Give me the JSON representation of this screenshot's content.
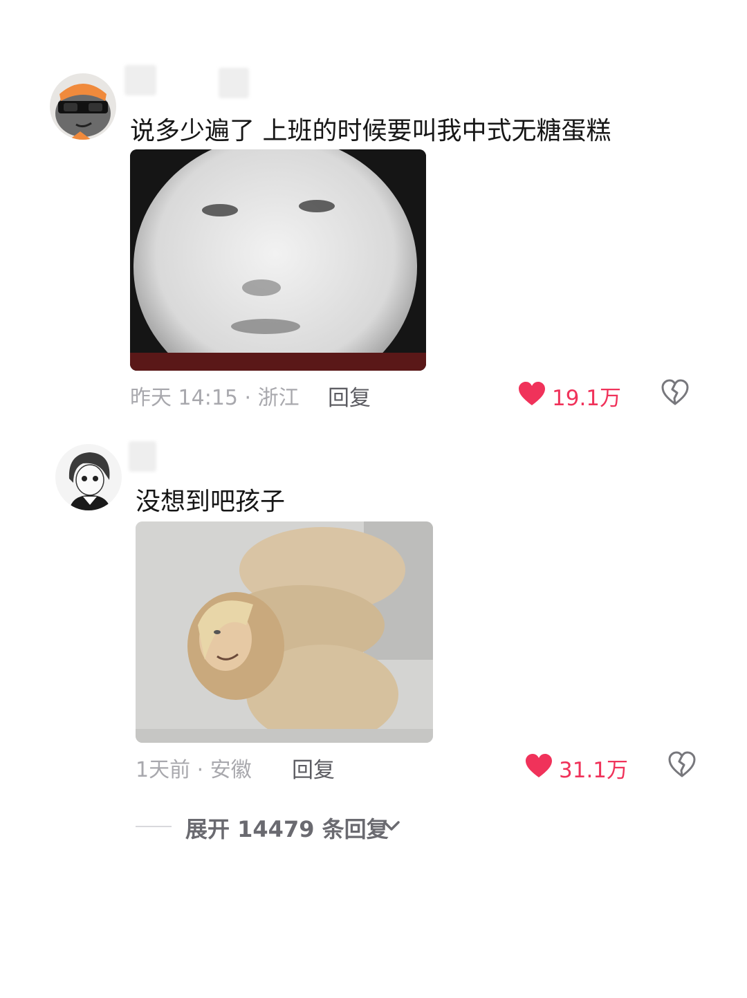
{
  "comments": [
    {
      "avatar_icon": "gray-cat-sunglasses-avatar",
      "text": "说多少遍了 上班的时候要叫我中式无糖蛋糕",
      "image_icon": "blurry-face-meme-image",
      "time_location": "昨天 14:15 · 浙江",
      "reply_label": "回复",
      "like_count": "19.1万",
      "like_color": "#f0325a"
    },
    {
      "avatar_icon": "anime-character-avatar",
      "text": "没想到吧孩子",
      "image_icon": "fish-cake-face-meme-image",
      "time_location": "1天前 · 安徽",
      "reply_label": "回复",
      "like_count": "31.1万",
      "like_color": "#f0325a"
    }
  ],
  "expand_replies": {
    "label": "展开 14479 条回复"
  }
}
